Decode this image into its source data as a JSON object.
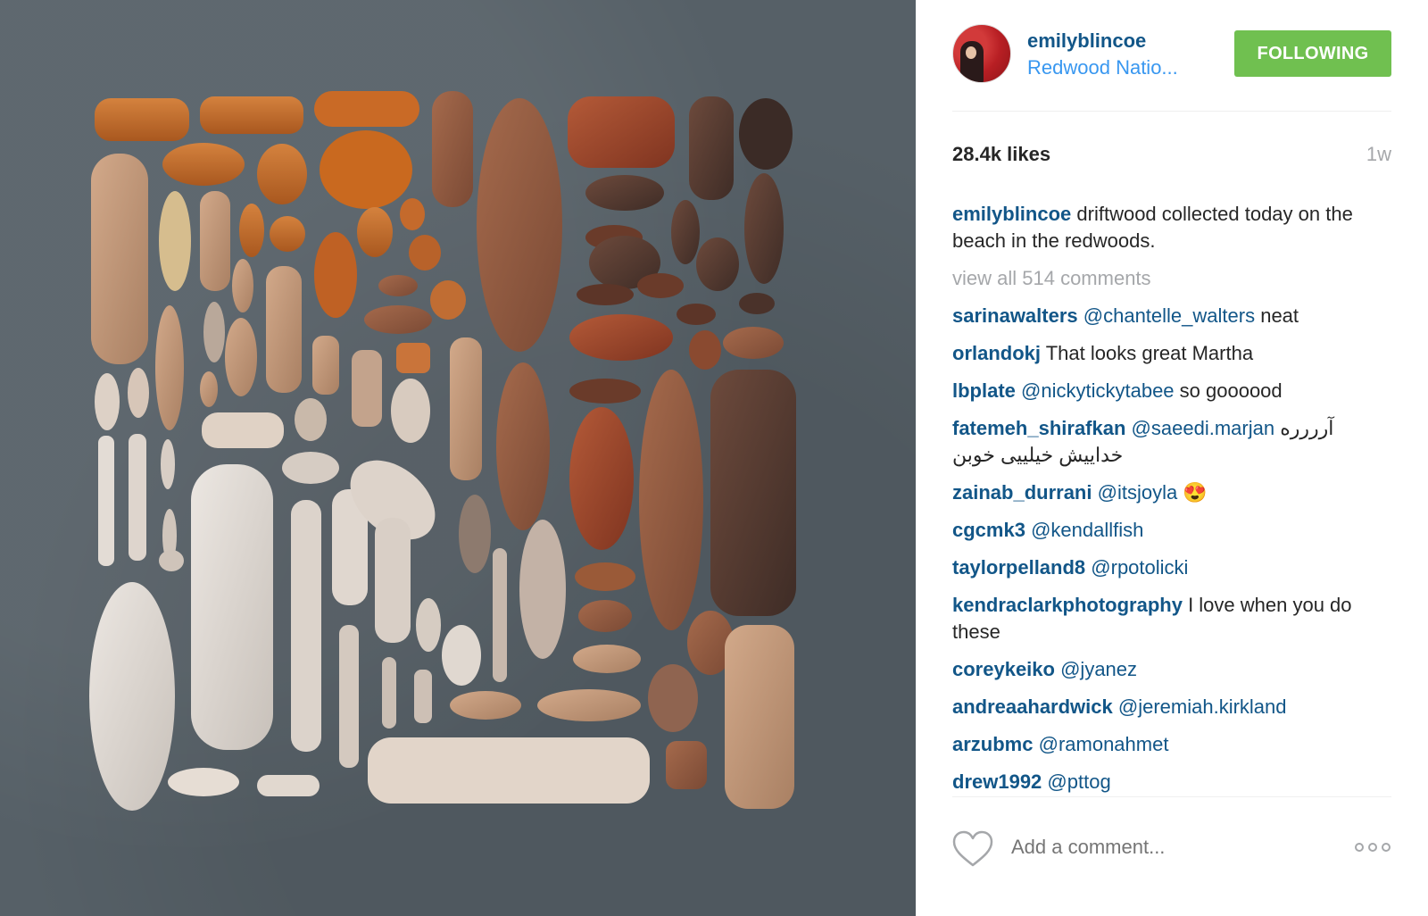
{
  "post": {
    "username": "emilyblincoe",
    "location": "Redwood Natio...",
    "follow_label": "FOLLOWING",
    "likes": "28.4k likes",
    "age": "1w",
    "caption_user": "emilyblincoe",
    "caption_text": " driftwood collected today on the beach in the redwoods.",
    "view_all": "view all 514 comments",
    "add_comment_placeholder": "Add a comment...",
    "accent_color": "#70c050",
    "username_color": "#125688"
  },
  "comments": [
    {
      "user": "sarinawalters",
      "mention": "@chantelle_walters",
      "text": " neat"
    },
    {
      "user": "orlandokj",
      "mention": "",
      "text": " That looks great Martha"
    },
    {
      "user": "lbplate",
      "mention": "@nickytickytabee",
      "text": " so goooood"
    },
    {
      "user": "fatemeh_shirafkan",
      "mention": "@saeedi.marjan",
      "text": " آرررره خداییش خیلییی خوبن"
    },
    {
      "user": "zainab_durrani",
      "mention": "@itsjoyla",
      "text": " 😍"
    },
    {
      "user": "cgcmk3",
      "mention": "@kendallfish",
      "text": ""
    },
    {
      "user": "taylorpelland8",
      "mention": "@rpotolicki",
      "text": ""
    },
    {
      "user": "kendraclarkphotography",
      "mention": "",
      "text": " I love when you do these"
    },
    {
      "user": "coreykeiko",
      "mention": "@jyanez",
      "text": ""
    },
    {
      "user": "andreaahardwick",
      "mention": "@jeremiah.kirkland",
      "text": ""
    },
    {
      "user": "arzubmc",
      "mention": "@ramonahmet",
      "text": ""
    },
    {
      "user": "drew1992",
      "mention": "@pttog",
      "text": ""
    }
  ],
  "icons": {
    "like": "heart-icon",
    "more": "more-options-icon"
  }
}
